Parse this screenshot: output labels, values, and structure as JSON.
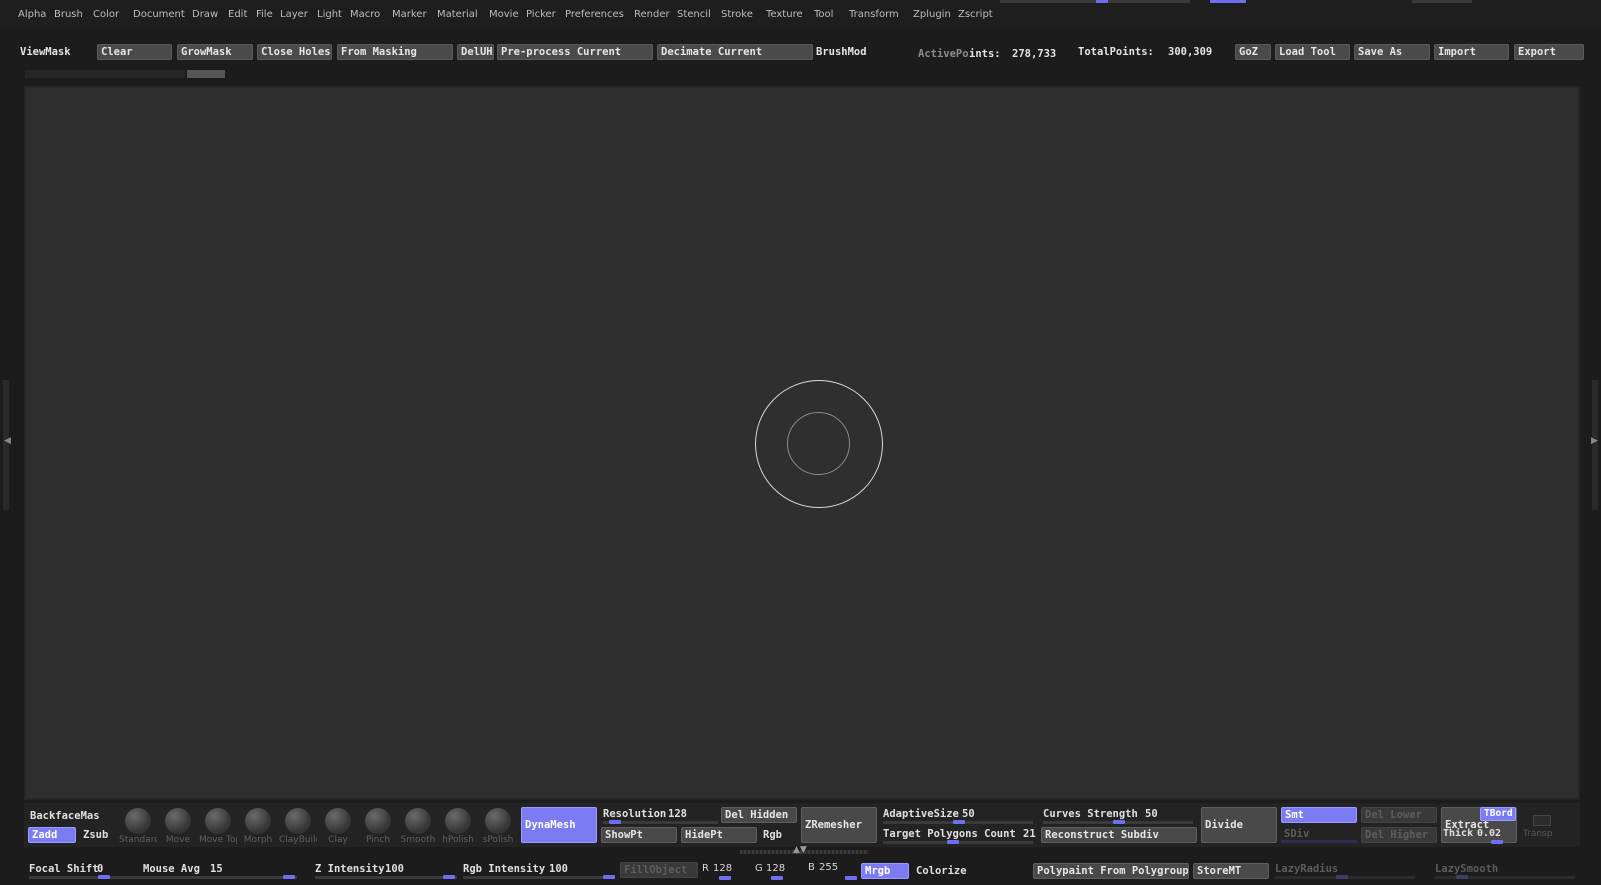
{
  "menu": {
    "items": [
      "Alpha",
      "Brush",
      "Color",
      "Document",
      "Draw",
      "Edit",
      "File",
      "Layer",
      "Light",
      "Macro",
      "Marker",
      "Material",
      "Movie",
      "Picker",
      "Preferences",
      "Render",
      "Stencil",
      "Stroke",
      "Texture",
      "Tool",
      "Transform",
      "Zplugin",
      "Zscript"
    ]
  },
  "toolbar": {
    "viewmask": "ViewMask",
    "clear": "Clear",
    "growmask": "GrowMask",
    "close_holes": "Close Holes",
    "from_masking": "From Masking",
    "deluh": "DelUH",
    "preprocess": "Pre-process Current",
    "decimate": "Decimate Current",
    "brushmod": "BrushMod",
    "active_points_label": "ActivePo",
    "active_points_rest": "ints:",
    "active_points": "278,733",
    "total_points_label": "TotalPoints:",
    "total_points": "300,309",
    "goz": "GoZ",
    "load_tool": "Load Tool",
    "save_as": "Save As",
    "import": "Import",
    "export": "Export"
  },
  "shelf": {
    "backface": "BackfaceMas",
    "zadd": "Zadd",
    "zsub": "Zsub",
    "brushes": [
      "Standard",
      "Move",
      "Move Topo",
      "Morph",
      "ClayBuildup",
      "Clay",
      "Pinch",
      "Smooth",
      "hPolish",
      "sPolish"
    ],
    "dynamesh": "DynaMesh",
    "resolution_label": "Resolution",
    "resolution": "128",
    "del_hidden": "Del Hidden",
    "showpt": "ShowPt",
    "hidept": "HidePt",
    "rgb": "Rgb",
    "zremesher": "ZRemesher",
    "adaptive_label": "AdaptiveSize",
    "adaptive": "50",
    "target_label": "Target Polygons Count",
    "target": "21",
    "curves_label": "Curves Strength",
    "curves": "50",
    "reconstruct": "Reconstruct Subdiv",
    "divide": "Divide",
    "smt": "Smt",
    "sdiv": "SDiv",
    "del_lower": "Del Lower",
    "del_higher": "Del Higher",
    "extract": "Extract",
    "tbord": "TBord",
    "thick_label": "Thick",
    "thick": "0.02",
    "transp": "Transp"
  },
  "status": {
    "focal_label": "Focal Shift",
    "focal": "0",
    "mouse_label": "Mouse Avg",
    "mouse": "15",
    "zint_label": "Z Intensity",
    "zint": "100",
    "rgbint_label": "Rgb Intensity",
    "rgbint": "100",
    "fillobject": "FillObject",
    "r_label": "R",
    "r": "128",
    "g_label": "G",
    "g": "128",
    "b_label": "B",
    "b": "255",
    "mrgb": "Mrgb",
    "colorize": "Colorize",
    "polypaint": "Polypaint From Polygroups",
    "storemt": "StoreMT",
    "lazyradius": "LazyRadius",
    "lazysmooth": "LazySmooth"
  },
  "colors": {
    "accent": "#7b7bf2",
    "background": "#1c1c1c",
    "viewport": "#2f2f2f"
  }
}
